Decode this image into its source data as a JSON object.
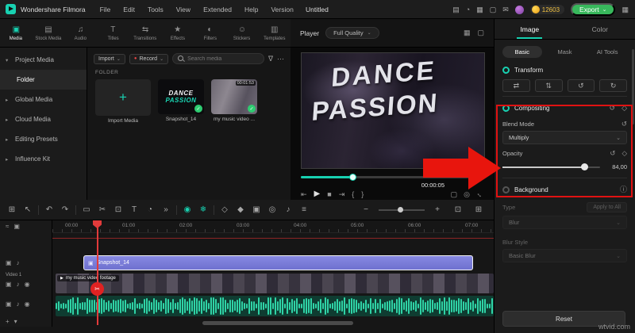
{
  "icons": {
    "chevron_down": "⌄",
    "chevron_right": "▸",
    "chevron_expanded": "▾",
    "plus": "+",
    "record_dot": "●",
    "more": "⋯",
    "filter": "∇",
    "check": "✓",
    "play": "▶",
    "stop": "■",
    "step_back": "⇤",
    "step_forward": "⇥",
    "brace_open": "{",
    "brace_close": "}",
    "undo": "↶",
    "redo": "↷",
    "scissors": "✂",
    "trash": "▭",
    "crop": "⊡",
    "text_tool": "T",
    "speed": "◔",
    "more_tools": "»",
    "render": "◉",
    "snowflake": "❄",
    "keyframe": "◇",
    "marker": "◆",
    "chroma": "▣",
    "motion": "◎",
    "mic": "♪",
    "mixer": "≡",
    "zoom_out": "−",
    "zoom_in": "+",
    "reset": "↺",
    "diamond": "◇",
    "flip_h": "⇄",
    "flip_v": "⇅",
    "rotate_l": "↺",
    "rotate_r": "↻",
    "info": "ⓘ",
    "grid": "⊞",
    "pointer": "↖",
    "layout": "▦",
    "camera": "◎",
    "screen": "▢",
    "expand": "↔",
    "eye": "◉",
    "speaker": "♪",
    "lock": "▣",
    "link": "≈",
    "devices": "▤",
    "notification": "◔",
    "resources": "▦",
    "display": "▢",
    "message": "✉",
    "tab_media": "▣",
    "tab_stock": "▤",
    "tab_audio": "♫",
    "tab_titles": "T",
    "tab_transitions": "⇆",
    "tab_effects": "★",
    "tab_filters": "◐",
    "tab_stickers": "☺",
    "tab_templates": "▥"
  },
  "titlebar": {
    "app_name": "Wondershare Filmora",
    "menus": [
      "File",
      "Edit",
      "Tools",
      "View",
      "Extended",
      "Help",
      "Version"
    ],
    "document_title": "Untitled",
    "coin_count": "12603",
    "export_label": "Export"
  },
  "media_tabs": {
    "items": [
      {
        "label": "Media"
      },
      {
        "label": "Stock Media"
      },
      {
        "label": "Audio"
      },
      {
        "label": "Titles"
      },
      {
        "label": "Transitions"
      },
      {
        "label": "Effects"
      },
      {
        "label": "Filters"
      },
      {
        "label": "Stickers"
      },
      {
        "label": "Templates"
      }
    ]
  },
  "player": {
    "label": "Player",
    "quality": "Full Quality"
  },
  "sidebar": {
    "items": [
      {
        "label": "Project Media"
      },
      {
        "label": "Folder"
      },
      {
        "label": "Global Media"
      },
      {
        "label": "Cloud Media"
      },
      {
        "label": "Editing Presets"
      },
      {
        "label": "Influence Kit"
      }
    ]
  },
  "media_browser": {
    "import_label": "Import",
    "record_label": "Record",
    "search_placeholder": "Search media",
    "section_label": "FOLDER",
    "tiles": [
      {
        "label": "Import Media"
      },
      {
        "label": "Snapshot_14",
        "thumb_line1": "DANCE",
        "thumb_line2": "PASSION"
      },
      {
        "label": "my music video ...",
        "duration": "00:01:53"
      }
    ]
  },
  "preview": {
    "overlay_line1": "DANCE",
    "overlay_line2": "PASSION",
    "timecode": "00:00:05",
    "progress_percent": 28
  },
  "right_panel": {
    "tabs": [
      {
        "label": "Image"
      },
      {
        "label": "Color"
      }
    ],
    "subtabs": [
      {
        "label": "Basic"
      },
      {
        "label": "Mask"
      },
      {
        "label": "AI Tools"
      }
    ],
    "transform": {
      "label": "Transform"
    },
    "compositing": {
      "label": "Compositing",
      "blend_mode_label": "Blend Mode",
      "blend_mode_value": "Multiply",
      "opacity_label": "Opacity",
      "opacity_value": "84,00",
      "opacity_percent": 84
    },
    "background": {
      "label": "Background",
      "type_label": "Type",
      "apply_all_label": "Apply to All",
      "type_value": "Blur",
      "blur_style_label": "Blur Style",
      "blur_style_value": "Basic Blur"
    },
    "reset_label": "Reset"
  },
  "timeline": {
    "ruler": [
      "00:00",
      "01:00",
      "02:00",
      "03:00",
      "04:00",
      "05:00",
      "06:00",
      "07:00"
    ],
    "track_video_label": "Video 1",
    "clips": {
      "snapshot": {
        "label": "Snapshot_14"
      },
      "video": {
        "label": "my music video footage"
      }
    }
  },
  "watermark": "wtvid.com",
  "colors": {
    "accent": "#18d1b1",
    "export_green": "#38b85c",
    "annotation_red": "#e01212",
    "clip_purple": "#7678d8",
    "audio_teal": "#2fd3a6",
    "coin_yellow": "#f0c040"
  }
}
